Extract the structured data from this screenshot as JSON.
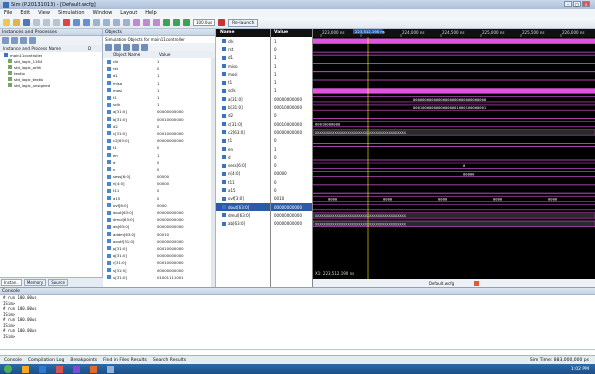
{
  "window": {
    "title": "Sim (P.20131013) - [Default.wcfg]"
  },
  "menu": [
    "File",
    "Edit",
    "View",
    "Simulation",
    "Window",
    "Layout",
    "Help"
  ],
  "toolbar": {
    "zoom": "100.0us",
    "relaunch": "Re-launch"
  },
  "left_panel": {
    "title": "Instances and Processes",
    "col1": "Instance and Process Name",
    "col2": "D",
    "items": [
      "main11controller",
      "std_logic_1164",
      "std_logic_arith",
      "textio",
      "std_logic_textio",
      "std_logic_unsigned"
    ],
    "tabs": [
      "Instan..",
      "Memory",
      "Source"
    ]
  },
  "objects_panel": {
    "title": "Objects",
    "subtitle": "Simulation Objects for main11controller",
    "col_name": "Object Name",
    "col_value": "Value",
    "rows": [
      [
        "clk",
        "1"
      ],
      [
        "rst",
        "0"
      ],
      [
        "d1",
        "1"
      ],
      [
        "miso",
        "1"
      ],
      [
        "mosi",
        "1"
      ],
      [
        "t1",
        "1"
      ],
      [
        "sclk",
        "1"
      ],
      [
        "a[31:0]",
        "00000000000"
      ],
      [
        "b[31:0]",
        "00010000000"
      ],
      [
        "d2",
        "0"
      ],
      [
        "c[31:0]",
        "00010000000"
      ],
      [
        "c2[63:0]",
        "00000000000"
      ],
      [
        "t1",
        "0"
      ],
      [
        "en",
        "1"
      ],
      [
        "d",
        "0"
      ],
      [
        "n",
        "0"
      ],
      [
        "sess[6:0]",
        "00000"
      ],
      [
        "n[4:0]",
        "00000"
      ],
      [
        "t11",
        "0"
      ],
      [
        "a15",
        "0"
      ],
      [
        "ovf[6:0]",
        "0000"
      ],
      [
        "dout[63:0]",
        "00000000000"
      ],
      [
        "dmul[63:0]",
        "00000000000"
      ],
      [
        "ab[63:0]",
        "00000000000"
      ],
      [
        "addm[63:0]",
        "00010"
      ],
      [
        "aoutf[31:0]",
        "00000000000"
      ],
      [
        "p[31:0]",
        "00010000000"
      ],
      [
        "q[31:0]",
        "00000000000"
      ],
      [
        "r[31:0]",
        "00010000000"
      ],
      [
        "s[31:0]",
        "00000000000"
      ],
      [
        "u[31:0]",
        "01001111001"
      ]
    ]
  },
  "wave": {
    "hdr_name": "Name",
    "hdr_value": "Value",
    "cursor": "223,512.190 ns",
    "times": [
      "223,000 ns",
      "223,500 ns",
      "224,000 ns",
      "224,500 ns",
      "225,000 ns",
      "225,500 ns",
      "226,000 ns"
    ],
    "rows": [
      [
        "clk",
        "1"
      ],
      [
        "rst",
        "0"
      ],
      [
        "d1",
        "1"
      ],
      [
        "miso",
        "1"
      ],
      [
        "mosi",
        "1"
      ],
      [
        "t1",
        "1"
      ],
      [
        "sclk",
        "1"
      ],
      [
        "a[31:0]",
        "00000000000"
      ],
      [
        "b[31:0]",
        "00010000000"
      ],
      [
        "d2",
        "0"
      ],
      [
        "c[31:0]",
        "00010000000"
      ],
      [
        "c2[63:0]",
        "00000000000"
      ],
      [
        "t1",
        "0"
      ],
      [
        "en",
        "1"
      ],
      [
        "d",
        "0"
      ],
      [
        "sess[6:0]",
        "0"
      ],
      [
        "n[4:0]",
        "00000"
      ],
      [
        "t11",
        "0"
      ],
      [
        "a15",
        "0"
      ],
      [
        "ovf[3:0]",
        "0010"
      ],
      [
        "dout[63:0]",
        "00000000000"
      ],
      [
        "dmul[63:0]",
        "00000000000"
      ],
      [
        "ab[63:0]",
        "00000000000"
      ]
    ],
    "bus_labels": {
      "a": "00000000000000000000000000000000",
      "b": "00010000000000000001000100000001",
      "c": "00010000000",
      "c2": "XXXXXXXXXXXXXXXXXXXXXXXXXXXXXXXXXXXXXXXXXX",
      "ovf": [
        "0000",
        "0000",
        "0000",
        "0000",
        "0000"
      ],
      "sess": "0",
      "n": "00000"
    },
    "xreadout": "X1: 223,512.190 ns",
    "tab": "Default.wcfg"
  },
  "console": {
    "title": "Console",
    "lines": [
      "# run 100.00us",
      "ISim>",
      "# run 100.00us",
      "ISim>",
      "# run 100.00us",
      "ISim>",
      "# run 100.00us",
      "ISim>"
    ],
    "tabs": [
      "Console",
      "Compilation Log",
      "Breakpoints",
      "Find in Files Results",
      "Search Results"
    ],
    "simtime": "Sim Time: 883,000,000 ps"
  },
  "clock": "1:02 PM"
}
